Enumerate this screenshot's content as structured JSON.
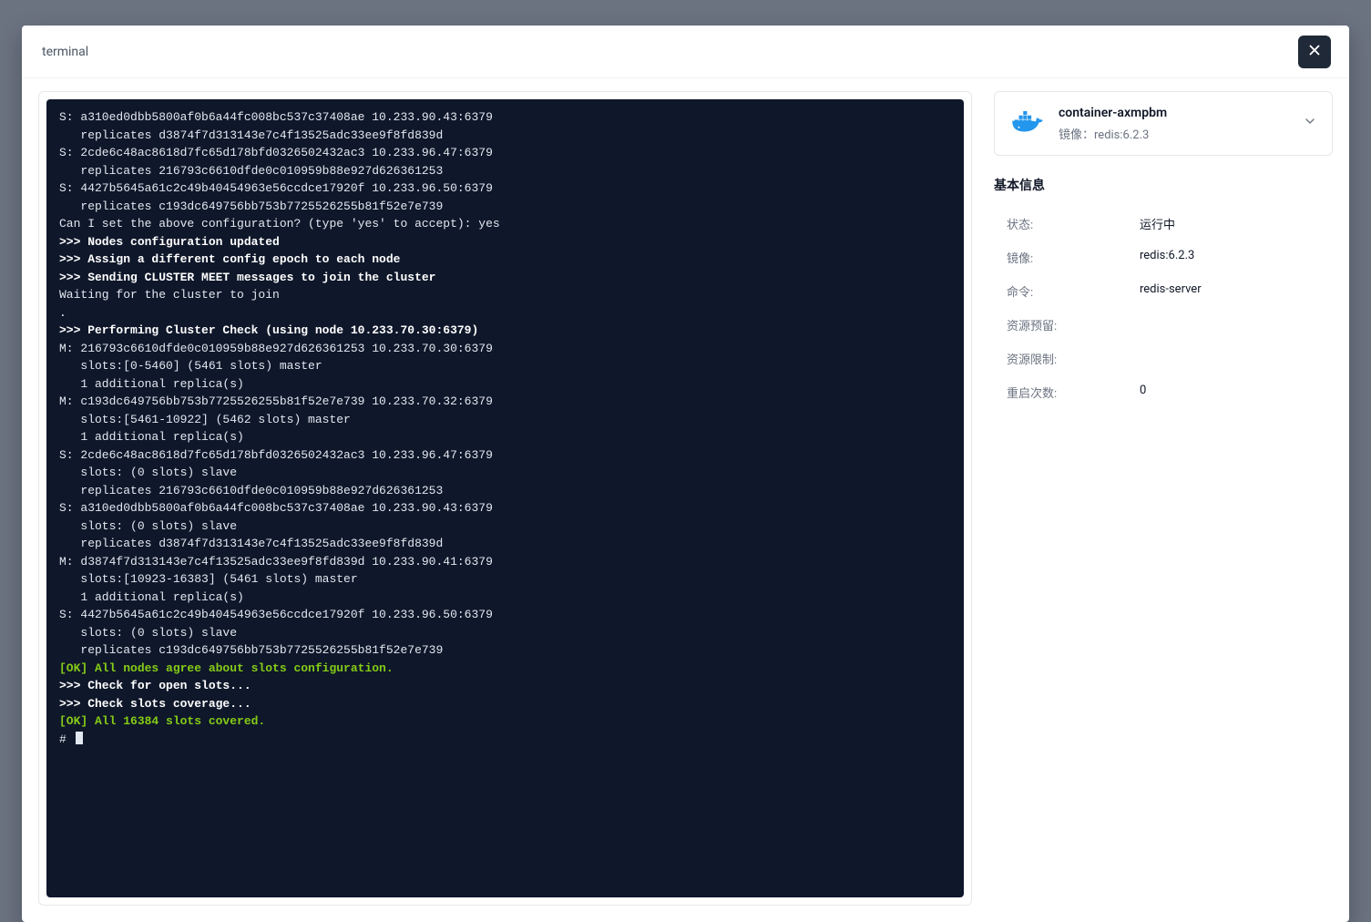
{
  "modal": {
    "title": "terminal"
  },
  "terminal": {
    "lines": [
      {
        "style": "plain",
        "text": "S: a310ed0dbb5800af0b6a44fc008bc537c37408ae 10.233.90.43:6379"
      },
      {
        "style": "plain",
        "text": "   replicates d3874f7d313143e7c4f13525adc33ee9f8fd839d"
      },
      {
        "style": "plain",
        "text": "S: 2cde6c48ac8618d7fc65d178bfd0326502432ac3 10.233.96.47:6379"
      },
      {
        "style": "plain",
        "text": "   replicates 216793c6610dfde0c010959b88e927d626361253"
      },
      {
        "style": "plain",
        "text": "S: 4427b5645a61c2c49b40454963e56ccdce17920f 10.233.96.50:6379"
      },
      {
        "style": "plain",
        "text": "   replicates c193dc649756bb753b7725526255b81f52e7e739"
      },
      {
        "style": "plain",
        "text": "Can I set the above configuration? (type 'yes' to accept): yes"
      },
      {
        "style": "bold",
        "text": ">>> Nodes configuration updated"
      },
      {
        "style": "bold",
        "text": ">>> Assign a different config epoch to each node"
      },
      {
        "style": "bold",
        "text": ">>> Sending CLUSTER MEET messages to join the cluster"
      },
      {
        "style": "plain",
        "text": "Waiting for the cluster to join"
      },
      {
        "style": "plain",
        "text": "."
      },
      {
        "style": "bold",
        "text": ">>> Performing Cluster Check (using node 10.233.70.30:6379)"
      },
      {
        "style": "plain",
        "text": "M: 216793c6610dfde0c010959b88e927d626361253 10.233.70.30:6379"
      },
      {
        "style": "plain",
        "text": "   slots:[0-5460] (5461 slots) master"
      },
      {
        "style": "plain",
        "text": "   1 additional replica(s)"
      },
      {
        "style": "plain",
        "text": "M: c193dc649756bb753b7725526255b81f52e7e739 10.233.70.32:6379"
      },
      {
        "style": "plain",
        "text": "   slots:[5461-10922] (5462 slots) master"
      },
      {
        "style": "plain",
        "text": "   1 additional replica(s)"
      },
      {
        "style": "plain",
        "text": "S: 2cde6c48ac8618d7fc65d178bfd0326502432ac3 10.233.96.47:6379"
      },
      {
        "style": "plain",
        "text": "   slots: (0 slots) slave"
      },
      {
        "style": "plain",
        "text": "   replicates 216793c6610dfde0c010959b88e927d626361253"
      },
      {
        "style": "plain",
        "text": "S: a310ed0dbb5800af0b6a44fc008bc537c37408ae 10.233.90.43:6379"
      },
      {
        "style": "plain",
        "text": "   slots: (0 slots) slave"
      },
      {
        "style": "plain",
        "text": "   replicates d3874f7d313143e7c4f13525adc33ee9f8fd839d"
      },
      {
        "style": "plain",
        "text": "M: d3874f7d313143e7c4f13525adc33ee9f8fd839d 10.233.90.41:6379"
      },
      {
        "style": "plain",
        "text": "   slots:[10923-16383] (5461 slots) master"
      },
      {
        "style": "plain",
        "text": "   1 additional replica(s)"
      },
      {
        "style": "plain",
        "text": "S: 4427b5645a61c2c49b40454963e56ccdce17920f 10.233.96.50:6379"
      },
      {
        "style": "plain",
        "text": "   slots: (0 slots) slave"
      },
      {
        "style": "plain",
        "text": "   replicates c193dc649756bb753b7725526255b81f52e7e739"
      },
      {
        "style": "ok",
        "text": "[OK] All nodes agree about slots configuration."
      },
      {
        "style": "bold",
        "text": ">>> Check for open slots..."
      },
      {
        "style": "bold",
        "text": ">>> Check slots coverage..."
      },
      {
        "style": "ok",
        "text": "[OK] All 16384 slots covered."
      },
      {
        "style": "prompt",
        "text": "# "
      }
    ]
  },
  "container": {
    "name": "container-axmpbm",
    "sub_prefix": "镜像：",
    "sub_value": "redis:6.2.3"
  },
  "info": {
    "section_title": "基本信息",
    "rows": [
      {
        "label": "状态:",
        "value": "运行中"
      },
      {
        "label": "镜像:",
        "value": "redis:6.2.3"
      },
      {
        "label": "命令:",
        "value": "redis-server"
      },
      {
        "label": "资源预留:",
        "value": ""
      },
      {
        "label": "资源限制:",
        "value": ""
      },
      {
        "label": "重启次数:",
        "value": "0"
      }
    ]
  }
}
